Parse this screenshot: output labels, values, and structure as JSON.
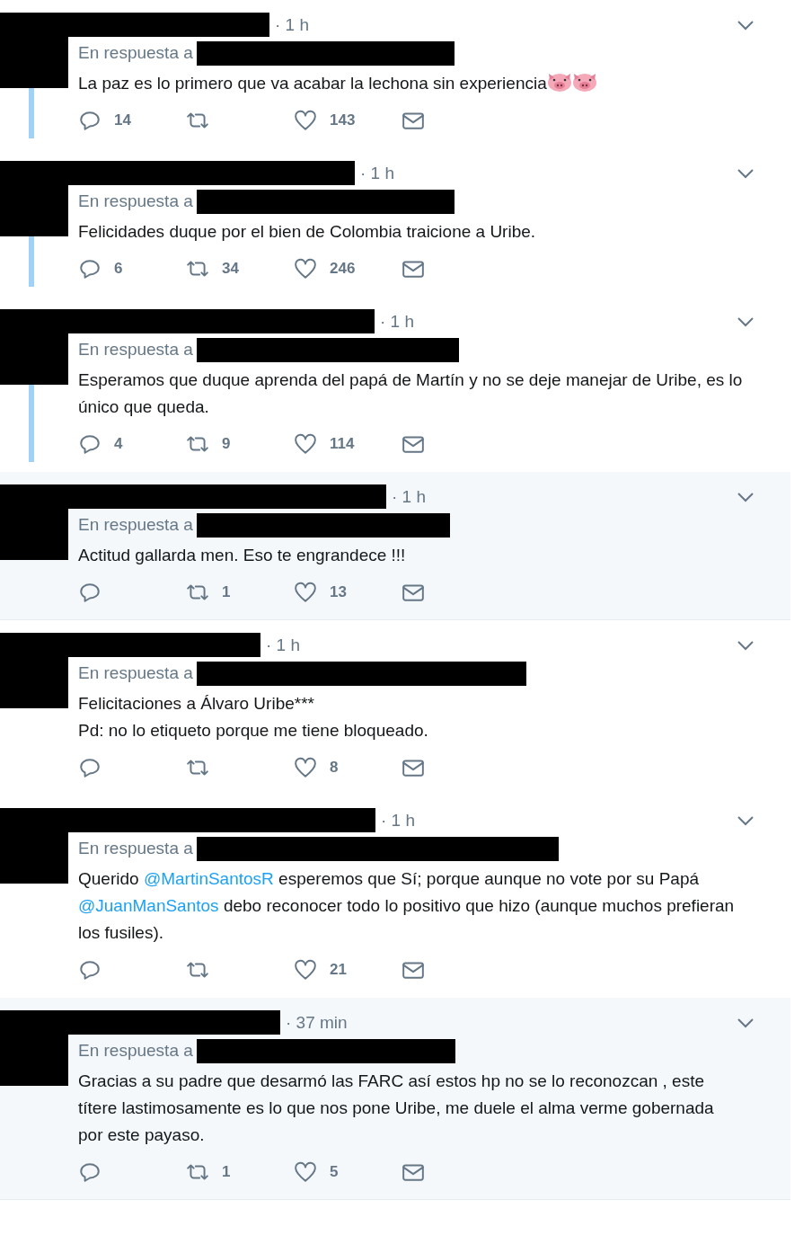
{
  "tweets": [
    {
      "time": "· 1 h",
      "reply_label": "En respuesta a",
      "highlighted": false,
      "thread_line": true,
      "text": [
        {
          "kind": "text",
          "t": "La paz es lo primero que va acabar la lechona sin experiencia"
        }
      ],
      "trailing_icons": [
        {
          "kind": "pig"
        },
        {
          "kind": "pig"
        }
      ],
      "replies": "14",
      "likes": "143"
    },
    {
      "time": "· 1 h",
      "reply_label": "En respuesta a",
      "highlighted": false,
      "thread_line": true,
      "text": [
        {
          "kind": "text",
          "t": "Felicidades duque por el bien de Colombia traicione a Uribe."
        }
      ],
      "replies": "6",
      "retweets": "34",
      "likes": "246"
    },
    {
      "time": "· 1 h",
      "reply_label": "En respuesta a",
      "highlighted": false,
      "thread_line": true,
      "text": [
        {
          "kind": "text",
          "t": "Esperamos que duque aprenda del papá de Martín y no se deje manejar de Uribe, es lo único que queda."
        }
      ],
      "replies": "4",
      "retweets": "9",
      "likes": "114"
    },
    {
      "time": "· 1 h",
      "reply_label": "En respuesta a",
      "highlighted": true,
      "thread_line": false,
      "text": [
        {
          "kind": "text",
          "t": "Actitud gallarda men. Eso te engrandece !!!"
        }
      ],
      "retweets": "1",
      "likes": "13"
    },
    {
      "time": "· 1 h",
      "reply_label": "En respuesta a",
      "highlighted": false,
      "thread_line": false,
      "text": [
        {
          "kind": "text",
          "t": "Felicitaciones a Álvaro Uribe***"
        },
        {
          "kind": "break"
        },
        {
          "kind": "text",
          "t": "Pd: no lo etiqueto porque me tiene bloqueado."
        }
      ],
      "likes": "8"
    },
    {
      "time": "· 1 h",
      "reply_label": "En respuesta a",
      "highlighted": false,
      "thread_line": false,
      "text": [
        {
          "kind": "text",
          "t": "Querido "
        },
        {
          "kind": "mention",
          "t": "@MartinSantosR"
        },
        {
          "kind": "text",
          "t": " esperemos que Sí; porque aunque no vote por su Papá "
        },
        {
          "kind": "mention",
          "t": "@JuanManSantos"
        },
        {
          "kind": "text",
          "t": " debo reconocer todo lo positivo que hizo (aunque muchos prefieran los fusiles)."
        }
      ],
      "likes": "21"
    },
    {
      "time": "· 37 min",
      "reply_label": "En respuesta a",
      "highlighted": true,
      "thread_line": false,
      "text": [
        {
          "kind": "text",
          "t": "Gracias a su padre que desarmó las FARC así estos hp no se lo reconozcan , este títere lastimosamente es lo que nos pone Uribe, me duele  el alma verme gobernada por este payaso."
        }
      ],
      "retweets": "1",
      "likes": "5"
    }
  ]
}
